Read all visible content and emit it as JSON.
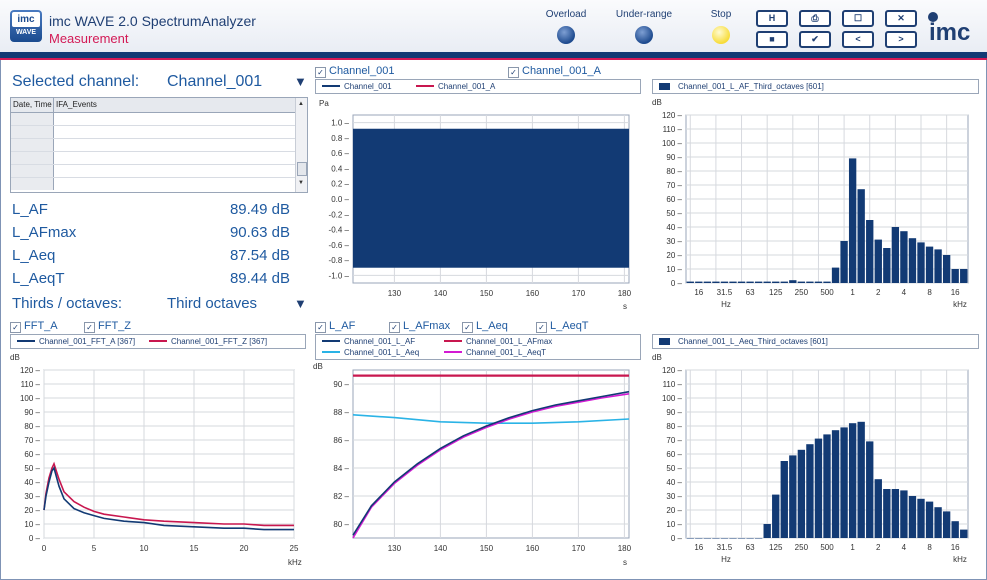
{
  "app": {
    "logo_top": "imc",
    "logo_bottom": "WAVE",
    "title": "imc WAVE 2.0 SpectrumAnalyzer",
    "subtitle": "Measurement"
  },
  "indicators": {
    "overload": "Overload",
    "underrange": "Under-range",
    "stop": "Stop"
  },
  "toolbar": [
    "H",
    "⎙",
    "☐",
    "✕",
    "■",
    "✔",
    "<",
    ">"
  ],
  "brand": "imc",
  "channel": {
    "label": "Selected channel:",
    "value": "Channel_001"
  },
  "events": {
    "col1": "Date, Time",
    "col2": "IFA_Events"
  },
  "metrics": [
    {
      "name": "L_AF",
      "value": "89.49 dB"
    },
    {
      "name": "L_AFmax",
      "value": "90.63 dB"
    },
    {
      "name": "L_Aeq",
      "value": "87.54 dB"
    },
    {
      "name": "L_AeqT",
      "value": "89.44 dB"
    }
  ],
  "thirds": {
    "label": "Thirds / octaves:",
    "value": "Third octaves"
  },
  "checks": {
    "ch1": "Channel_001",
    "ch1a": "Channel_001_A",
    "fftA": "FFT_A",
    "fftZ": "FFT_Z",
    "laf": "L_AF",
    "lafmax": "L_AFmax",
    "laeq": "L_Aeq",
    "laeqt": "L_AeqT"
  },
  "legends": {
    "time": [
      "Channel_001",
      "Channel_001_A"
    ],
    "third_af": "Channel_001_L_AF_Third_octaves [601]",
    "fft": [
      "Channel_001_FFT_A [367]",
      "Channel_001_FFT_Z [367]"
    ],
    "levels": [
      "Channel_001_L_AF",
      "Channel_001_L_AFmax",
      "Channel_001_L_Aeq",
      "Channel_001_L_AeqT"
    ],
    "third_aeq": "Channel_001_L_Aeq_Third_octaves [601]"
  },
  "colors": {
    "navy": "#123a74",
    "crimson": "#c8174f",
    "cyan": "#2ab3e6",
    "magenta": "#d31ad3",
    "grid": "#d6d9de"
  },
  "chart_data": [
    {
      "type": "area",
      "xlabel": "s",
      "ylabel": "Pa",
      "xlim": [
        121,
        181
      ],
      "ylim": [
        -1.1,
        1.1
      ],
      "xticks": [
        130,
        140,
        150,
        160,
        170,
        180
      ],
      "yticks": [
        "1.0",
        "0.8",
        "0.6",
        "0.4",
        "0.2",
        "0.0",
        "-0.2",
        "-0.4",
        "-0.6",
        "-0.8",
        "-1.0"
      ],
      "series": [
        {
          "name": "Channel_001",
          "band": [
            -0.9,
            0.92
          ]
        }
      ]
    },
    {
      "type": "bar",
      "xlabel": "Hz",
      "xlabel2": "kHz",
      "ylabel": "dB",
      "ylim": [
        0,
        120
      ],
      "xticks": [
        "16",
        "31.5",
        "63",
        "125",
        "250",
        "500",
        "1",
        "2",
        "4",
        "8",
        "16"
      ],
      "values": [
        1,
        1,
        1,
        1,
        1,
        1,
        1,
        1,
        1,
        1,
        1,
        1,
        2,
        1,
        1,
        1,
        1,
        11,
        30,
        89,
        67,
        45,
        31,
        25,
        40,
        37,
        32,
        29,
        26,
        24,
        20,
        10,
        10
      ]
    },
    {
      "type": "line",
      "xlabel": "kHz",
      "ylabel": "dB",
      "xlim": [
        0,
        25
      ],
      "ylim": [
        0,
        120
      ],
      "xticks": [
        0,
        5,
        10,
        15,
        20,
        25
      ],
      "yticks": [
        0,
        10,
        20,
        30,
        40,
        50,
        60,
        70,
        80,
        90,
        100,
        110,
        120
      ],
      "series": [
        {
          "name": "Channel_001_FFT_A [367]",
          "x": [
            0,
            0.2,
            0.5,
            0.8,
            1,
            1.5,
            2,
            3,
            4,
            5,
            6,
            8,
            10,
            12,
            15,
            18,
            20,
            22,
            25
          ],
          "y": [
            20,
            30,
            40,
            48,
            50,
            37,
            28,
            21,
            18,
            16,
            14,
            12,
            11,
            9,
            8,
            7,
            7,
            6,
            6
          ]
        },
        {
          "name": "Channel_001_FFT_Z [367]",
          "x": [
            0,
            0.2,
            0.5,
            0.8,
            1,
            1.5,
            2,
            3,
            4,
            5,
            6,
            8,
            10,
            12,
            15,
            18,
            20,
            22,
            25
          ],
          "y": [
            20,
            32,
            43,
            50,
            53,
            42,
            33,
            26,
            22,
            19,
            17,
            15,
            13,
            12,
            11,
            10,
            10,
            9,
            9
          ]
        }
      ]
    },
    {
      "type": "line",
      "xlabel": "s",
      "ylabel": "dB",
      "xlim": [
        121,
        181
      ],
      "ylim": [
        79,
        91
      ],
      "xticks": [
        130,
        140,
        150,
        160,
        170,
        180
      ],
      "yticks": [
        80,
        82,
        84,
        86,
        88,
        90
      ],
      "series": [
        {
          "name": "Channel_001_L_AF",
          "x": [
            121,
            125,
            130,
            135,
            140,
            145,
            150,
            155,
            160,
            165,
            170,
            175,
            181
          ],
          "y": [
            79.2,
            81.3,
            83,
            84.3,
            85.4,
            86.3,
            87,
            87.6,
            88.1,
            88.5,
            88.8,
            89.1,
            89.45
          ]
        },
        {
          "name": "Channel_001_L_AFmax",
          "x": [
            121,
            181
          ],
          "y": [
            90.6,
            90.6
          ]
        },
        {
          "name": "Channel_001_L_Aeq",
          "x": [
            121,
            130,
            140,
            150,
            160,
            170,
            181
          ],
          "y": [
            87.8,
            87.6,
            87.3,
            87.2,
            87.2,
            87.3,
            87.5
          ]
        },
        {
          "name": "Channel_001_L_AeqT",
          "x": [
            121,
            125,
            130,
            135,
            140,
            145,
            150,
            155,
            160,
            165,
            170,
            175,
            181
          ],
          "y": [
            79,
            81.2,
            82.9,
            84.2,
            85.3,
            86.2,
            86.9,
            87.5,
            88,
            88.4,
            88.7,
            89,
            89.3
          ]
        }
      ]
    },
    {
      "type": "bar",
      "xlabel": "Hz",
      "xlabel2": "kHz",
      "ylabel": "dB",
      "ylim": [
        0,
        120
      ],
      "xticks": [
        "16",
        "31.5",
        "63",
        "125",
        "250",
        "500",
        "1",
        "2",
        "4",
        "8",
        "16"
      ],
      "values": [
        0,
        0,
        0,
        0,
        0,
        0,
        0,
        0,
        0,
        10,
        31,
        55,
        59,
        63,
        67,
        71,
        74,
        77,
        79,
        82,
        83,
        69,
        42,
        35,
        35,
        34,
        30,
        28,
        26,
        22,
        19,
        12,
        6
      ]
    }
  ]
}
